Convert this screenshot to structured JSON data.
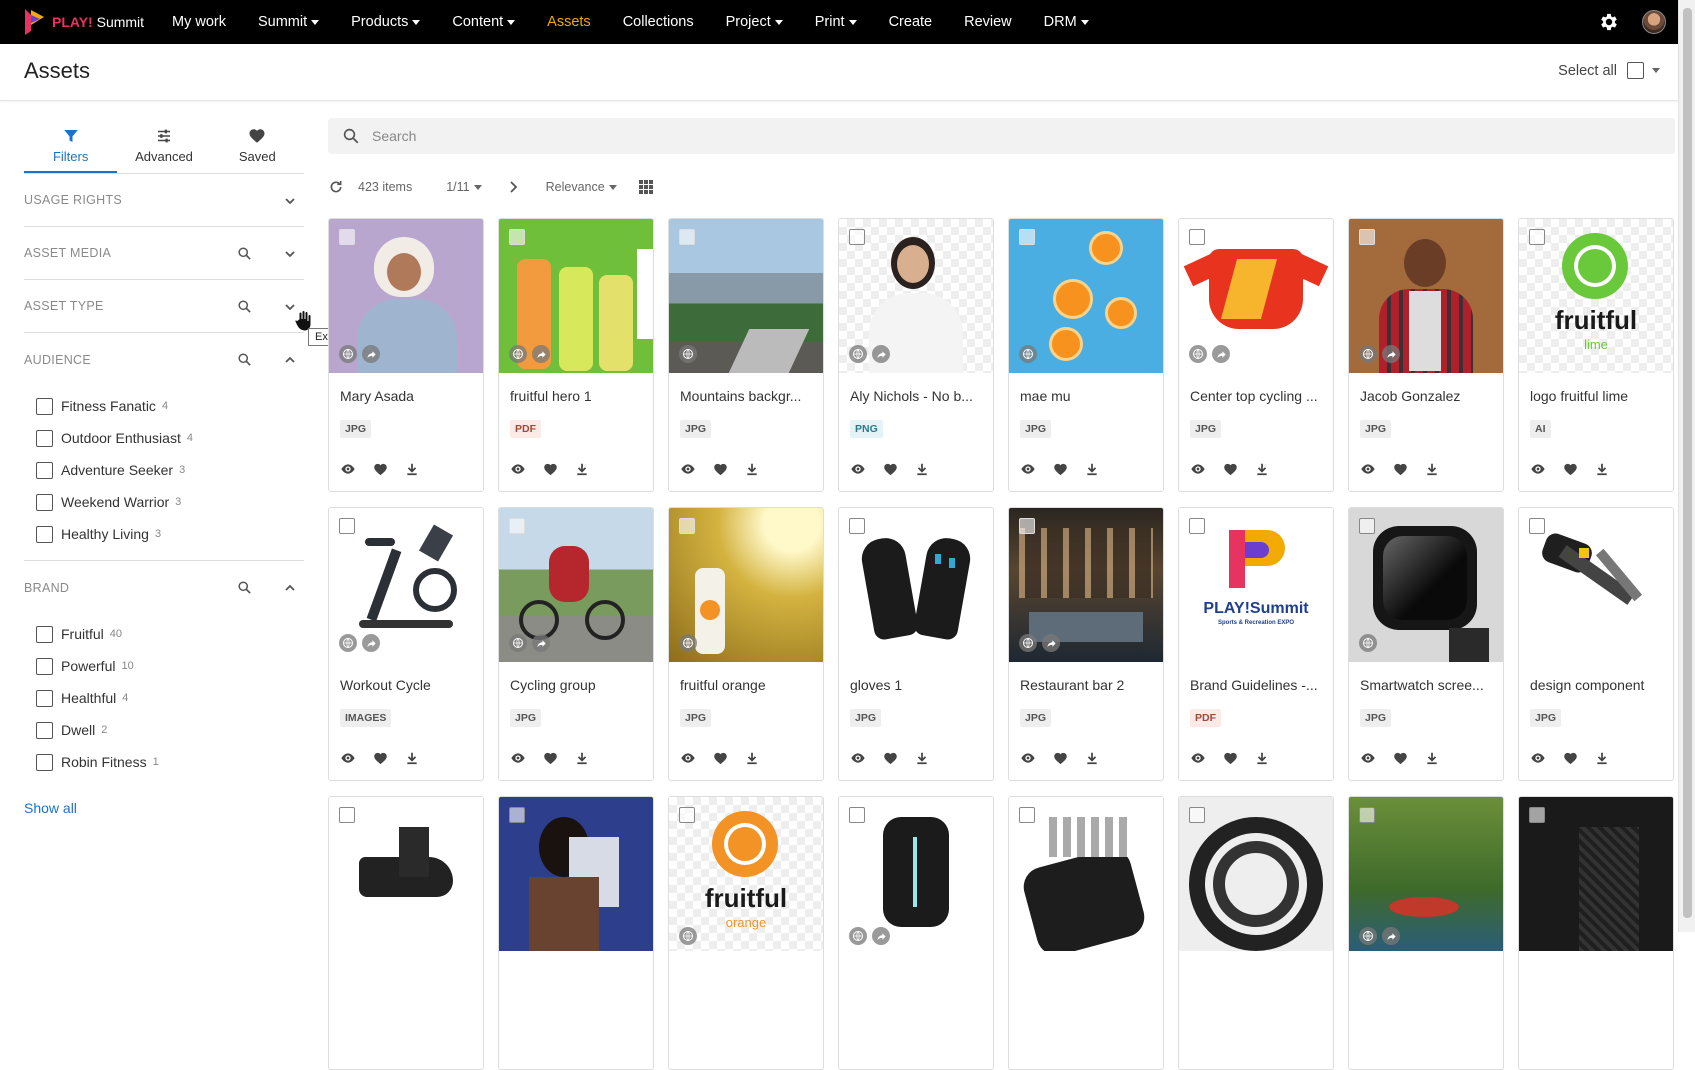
{
  "app": {
    "logo_brand": "PLAY!",
    "logo_name": "Summit",
    "nav": [
      {
        "label": "My work",
        "caret": false,
        "active": false
      },
      {
        "label": "Summit",
        "caret": true,
        "active": false
      },
      {
        "label": "Products",
        "caret": true,
        "active": false
      },
      {
        "label": "Content",
        "caret": true,
        "active": false
      },
      {
        "label": "Assets",
        "caret": false,
        "active": true
      },
      {
        "label": "Collections",
        "caret": false,
        "active": false
      },
      {
        "label": "Project",
        "caret": true,
        "active": false
      },
      {
        "label": "Print",
        "caret": true,
        "active": false
      },
      {
        "label": "Create",
        "caret": false,
        "active": false
      },
      {
        "label": "Review",
        "caret": false,
        "active": false
      },
      {
        "label": "DRM",
        "caret": true,
        "active": false
      }
    ],
    "accent_color": "#f2a900",
    "link_color": "#1a73c8"
  },
  "page": {
    "title": "Assets",
    "select_all_label": "Select all"
  },
  "sidebar": {
    "tabs": [
      {
        "label": "Filters",
        "icon": "filter-icon",
        "active": true
      },
      {
        "label": "Advanced",
        "icon": "sliders-icon",
        "active": false
      },
      {
        "label": "Saved",
        "icon": "heart-icon",
        "active": false
      }
    ],
    "facets": {
      "usage_rights": "USAGE RIGHTS",
      "asset_media": "ASSET MEDIA",
      "asset_type": "ASSET TYPE",
      "audience": "AUDIENCE",
      "brand": "BRAND"
    },
    "audience_options": [
      {
        "label": "Fitness Fanatic",
        "count": "4"
      },
      {
        "label": "Outdoor Enthusiast",
        "count": "4"
      },
      {
        "label": "Adventure Seeker",
        "count": "3"
      },
      {
        "label": "Weekend Warrior",
        "count": "3"
      },
      {
        "label": "Healthy Living",
        "count": "3"
      }
    ],
    "brand_options": [
      {
        "label": "Fruitful",
        "count": "40"
      },
      {
        "label": "Powerful",
        "count": "10"
      },
      {
        "label": "Healthful",
        "count": "4"
      },
      {
        "label": "Dwell",
        "count": "2"
      },
      {
        "label": "Robin Fitness",
        "count": "1"
      }
    ],
    "show_all": "Show all",
    "tooltip": "Expand"
  },
  "search": {
    "placeholder": "Search",
    "value": ""
  },
  "toolbar": {
    "items": "423 items",
    "page": "1/11",
    "sort": "Relevance"
  },
  "assets": [
    {
      "title": "Mary Asada",
      "type": "JPG"
    },
    {
      "title": "fruitful hero 1",
      "type": "PDF"
    },
    {
      "title": "Mountains backgr...",
      "type": "JPG"
    },
    {
      "title": "Aly Nichols - No b...",
      "type": "PNG"
    },
    {
      "title": "mae mu",
      "type": "JPG"
    },
    {
      "title": "Center top cycling ...",
      "type": "JPG"
    },
    {
      "title": "Jacob Gonzalez",
      "type": "JPG"
    },
    {
      "title": "logo fruitful lime",
      "type": "AI"
    },
    {
      "title": "Workout Cycle",
      "type": "IMAGES"
    },
    {
      "title": "Cycling group",
      "type": "JPG"
    },
    {
      "title": "fruitful orange",
      "type": "JPG"
    },
    {
      "title": "gloves 1",
      "type": "JPG"
    },
    {
      "title": "Restaurant bar 2",
      "type": "JPG"
    },
    {
      "title": "Brand Guidelines -...",
      "type": "PDF"
    },
    {
      "title": "Smartwatch scree...",
      "type": "JPG"
    },
    {
      "title": "design component",
      "type": "JPG"
    }
  ],
  "thumb_text": {
    "fruitful_word": "fruitful",
    "lime_word": "lime",
    "orange_word": "orange",
    "play_word": "PLAY!Summit",
    "play_sub": "Sports & Recreation EXPO"
  }
}
